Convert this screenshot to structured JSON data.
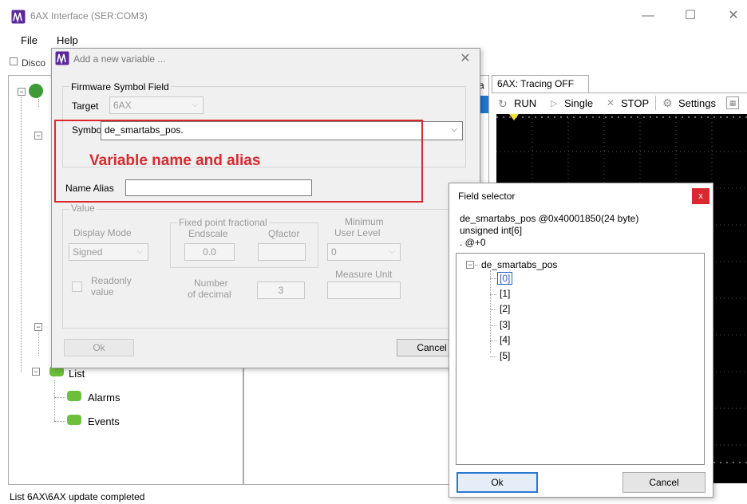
{
  "window": {
    "title": "6AX Interface (SER:COM3)",
    "minimize": "—",
    "maximize": "☐",
    "close": "✕"
  },
  "menu": {
    "file": "File",
    "help": "Help"
  },
  "discover": {
    "label": "Disco"
  },
  "tree": {
    "list_label": "List",
    "alarms_label": "Alarms",
    "events_label": "Events"
  },
  "trace": {
    "tab_label": "6AX: Tracing OFF",
    "run_label": "RUN",
    "single_label": "Single",
    "stop_label": "STOP",
    "settings_label": "Settings",
    "side_tab_fragment": "a"
  },
  "status": {
    "text": "List 6AX\\6AX update completed"
  },
  "dialog": {
    "title": "Add a new variable ...",
    "close": "✕",
    "firmware_group": "Firmware Symbol Field",
    "target_label": "Target",
    "target_value": "6AX",
    "symbol_label": "Symbol",
    "symbol_value": "de_smartabs_pos.",
    "name_alias_label": "Name Alias",
    "name_alias_value": "",
    "value_group": "Value",
    "display_mode_label": "Display Mode",
    "display_mode_value": "Signed",
    "fixed_point_group": "Fixed point fractional",
    "endscale_label": "Endscale",
    "endscale_value": "0.0",
    "qfactor_label": "Qfactor",
    "qfactor_value": "",
    "min_user_level_label_1": "Minimum",
    "min_user_level_label_2": "User Level",
    "min_user_level_value": "0",
    "readonly_label_1": "Readonly",
    "readonly_label_2": "value",
    "decimal_label_1": "Number",
    "decimal_label_2": "of decimal",
    "decimal_value": "3",
    "measure_unit_label": "Measure Unit",
    "measure_unit_value": "",
    "ok_label": "Ok",
    "cancel_label": "Cancel",
    "annotation": "Variable name and alias"
  },
  "field_selector": {
    "title": "Field selector",
    "close": "x",
    "info_line1": "de_smartabs_pos @0x40001850(24 byte)",
    "info_line2": "unsigned int[6]",
    "info_line3": ". @+0",
    "root": "de_smartabs_pos",
    "items": [
      "[0]",
      "[1]",
      "[2]",
      "[3]",
      "[4]",
      "[5]"
    ],
    "selected_index": 0,
    "ok_label": "Ok",
    "cancel_label": "Cancel"
  },
  "colors": {
    "accent_red": "#d9282f",
    "selection_blue": "#2b5fc7",
    "tree_icon_green": "#6cbf3b",
    "scope_background": "#000000",
    "scope_marker": "#f4e23c"
  }
}
